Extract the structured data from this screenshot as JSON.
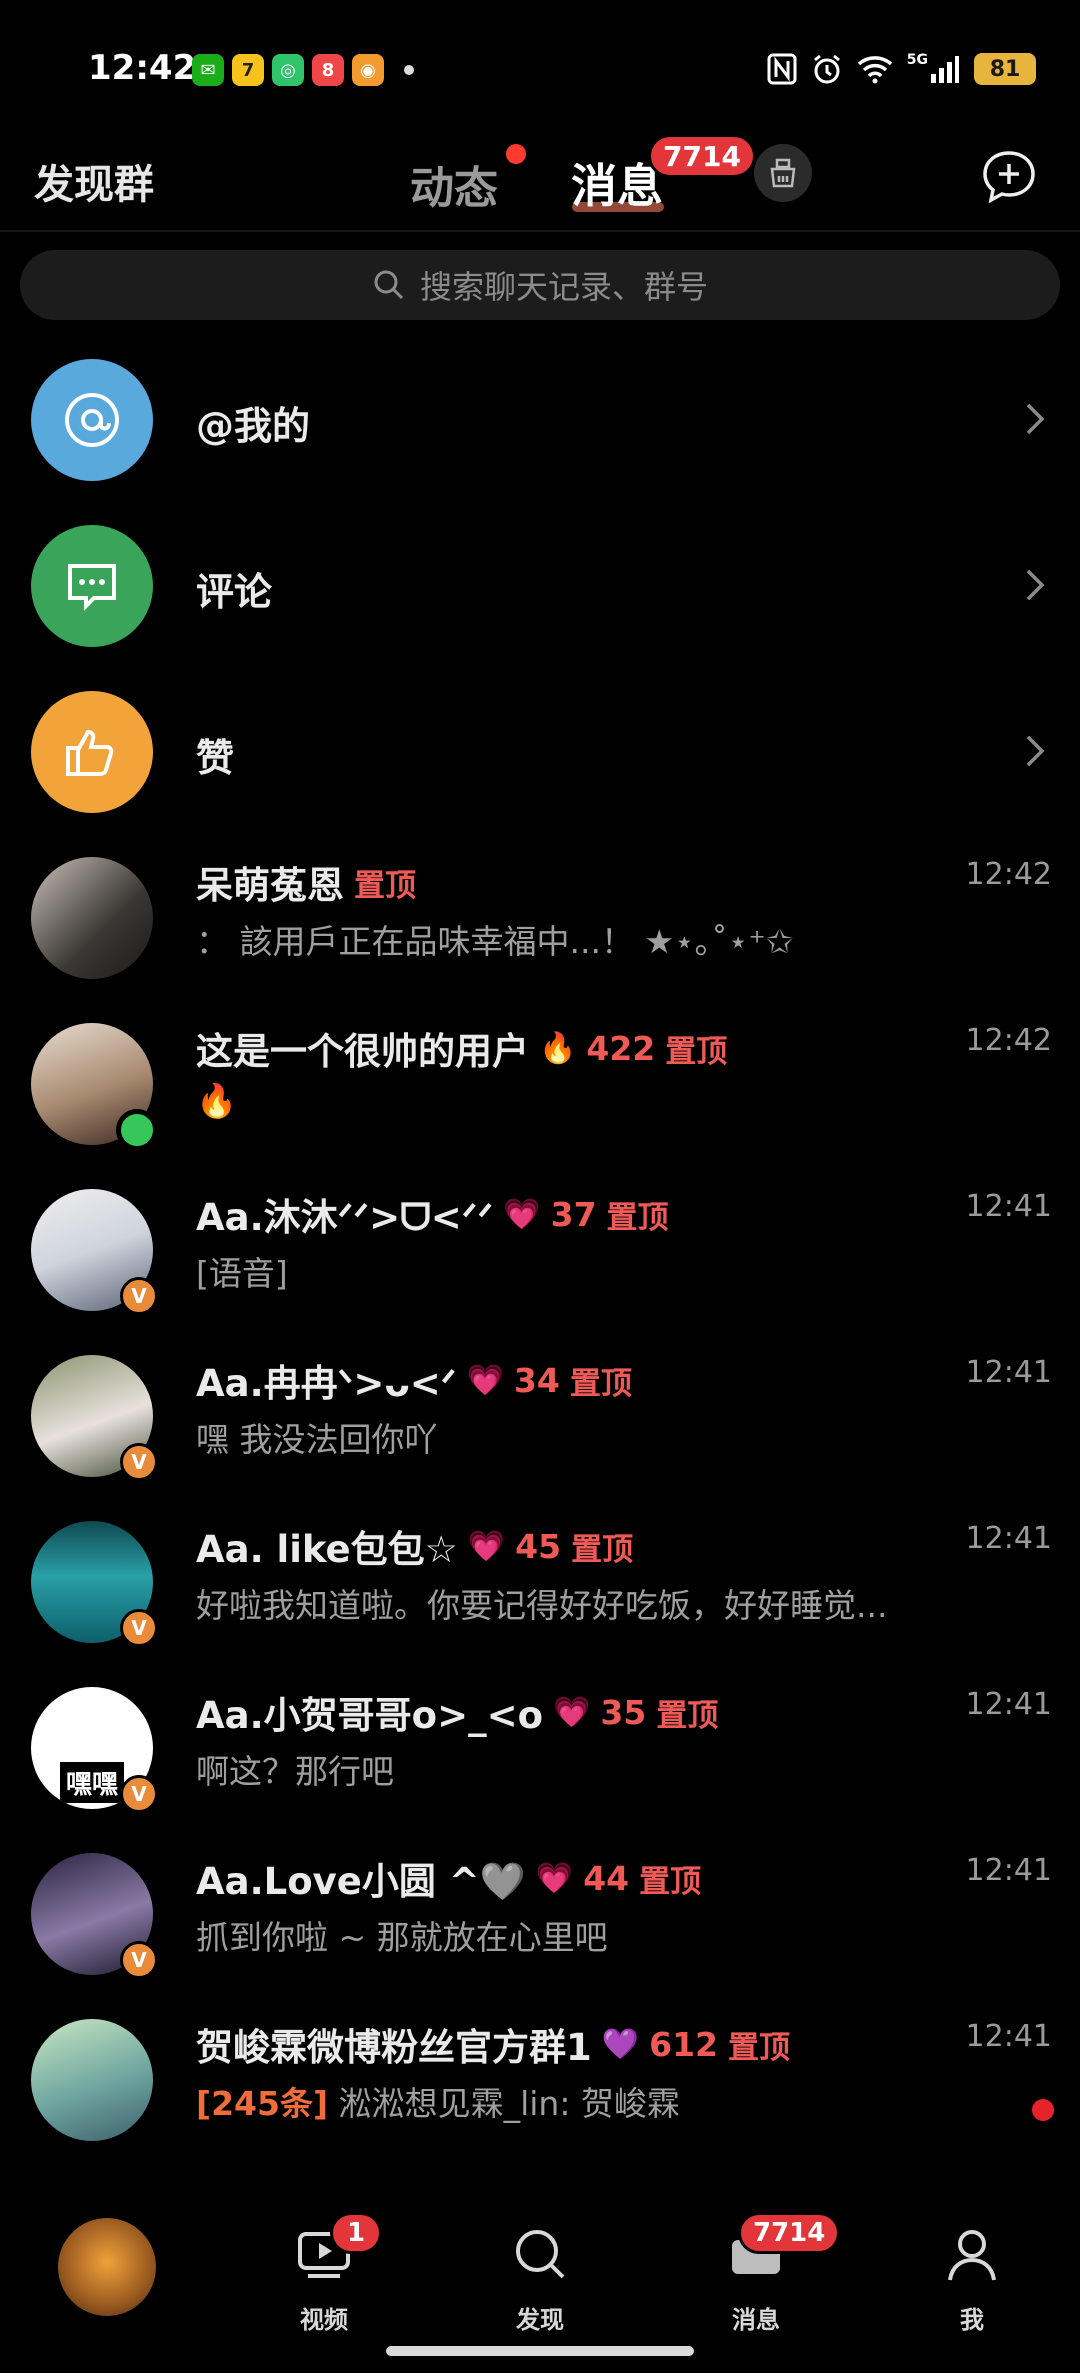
{
  "status_bar": {
    "time": "12:42",
    "battery": "81",
    "network": "5G",
    "apps": [
      "wechat-icon",
      "meituan-icon",
      "app-green-icon",
      "xiaohongshu-icon",
      "weibo-icon"
    ]
  },
  "top_nav": {
    "find_group": "发现群",
    "tab_dynamic": "动态",
    "tab_messages": "消息",
    "messages_badge": "7714"
  },
  "search": {
    "placeholder": "搜索聊天记录、群号"
  },
  "shortcuts": [
    {
      "label": "@我的",
      "color": "#5aa9dc",
      "icon": "at-icon"
    },
    {
      "label": "评论",
      "color": "#3aa55a",
      "icon": "comment-icon"
    },
    {
      "label": "赞",
      "color": "#f2a33a",
      "icon": "thumbs-up-icon"
    }
  ],
  "chats": [
    {
      "name": "呆萌菟恩",
      "extra": "",
      "count": "",
      "pin": "置顶",
      "time": "12:42",
      "preview": "：  該用戶正在品味幸福中...！ ★⋆｡˚⋆⁺✩",
      "badge": "none"
    },
    {
      "name": "这是一个很帅的用户",
      "extra": "🔥",
      "count": "422",
      "pin": "置顶",
      "time": "12:42",
      "preview": "🔥",
      "badge": "online"
    },
    {
      "name": "Aa.沐沐ᐟᐟ>ᗜ<ᐟᐟ",
      "extra": "💗",
      "count": "37",
      "pin": "置顶",
      "time": "12:41",
      "preview": "[语音]",
      "badge": "v"
    },
    {
      "name": "Aa.冉冉ᐠ>ᴗ<ᐟ",
      "extra": "💗",
      "count": "34",
      "pin": "置顶",
      "time": "12:41",
      "preview": "嘿 我没法回你吖",
      "badge": "v"
    },
    {
      "name": "Aa. like包包☆",
      "extra": "💗",
      "count": "45",
      "pin": "置顶",
      "time": "12:41",
      "preview": "好啦我知道啦。你要记得好好吃饭，好好睡觉...",
      "badge": "v"
    },
    {
      "name": "Aa.小贺哥哥o>_<o",
      "extra": "💗",
      "count": "35",
      "pin": "置顶",
      "time": "12:41",
      "preview": "啊这？那行吧",
      "badge": "v",
      "avatar_text": "嘿嘿"
    },
    {
      "name": "Aa.Love小圆 ^🩶",
      "extra": "💗",
      "count": "44",
      "pin": "置顶",
      "time": "12:41",
      "preview": "抓到你啦 ~ 那就放在心里吧",
      "badge": "v"
    },
    {
      "name": "贺峻霖微博粉丝官方群1",
      "extra": "💜",
      "count": "612",
      "pin": "置顶",
      "time": "12:41",
      "preview_highlight": "[245条]",
      "preview": "淞淞想见霖_lin: 贺峻霖",
      "badge": "none",
      "unread_dot": true
    }
  ],
  "bottom_nav": {
    "video": "视频",
    "video_badge": "1",
    "discover": "发现",
    "messages": "消息",
    "messages_badge": "7714",
    "me": "我"
  }
}
